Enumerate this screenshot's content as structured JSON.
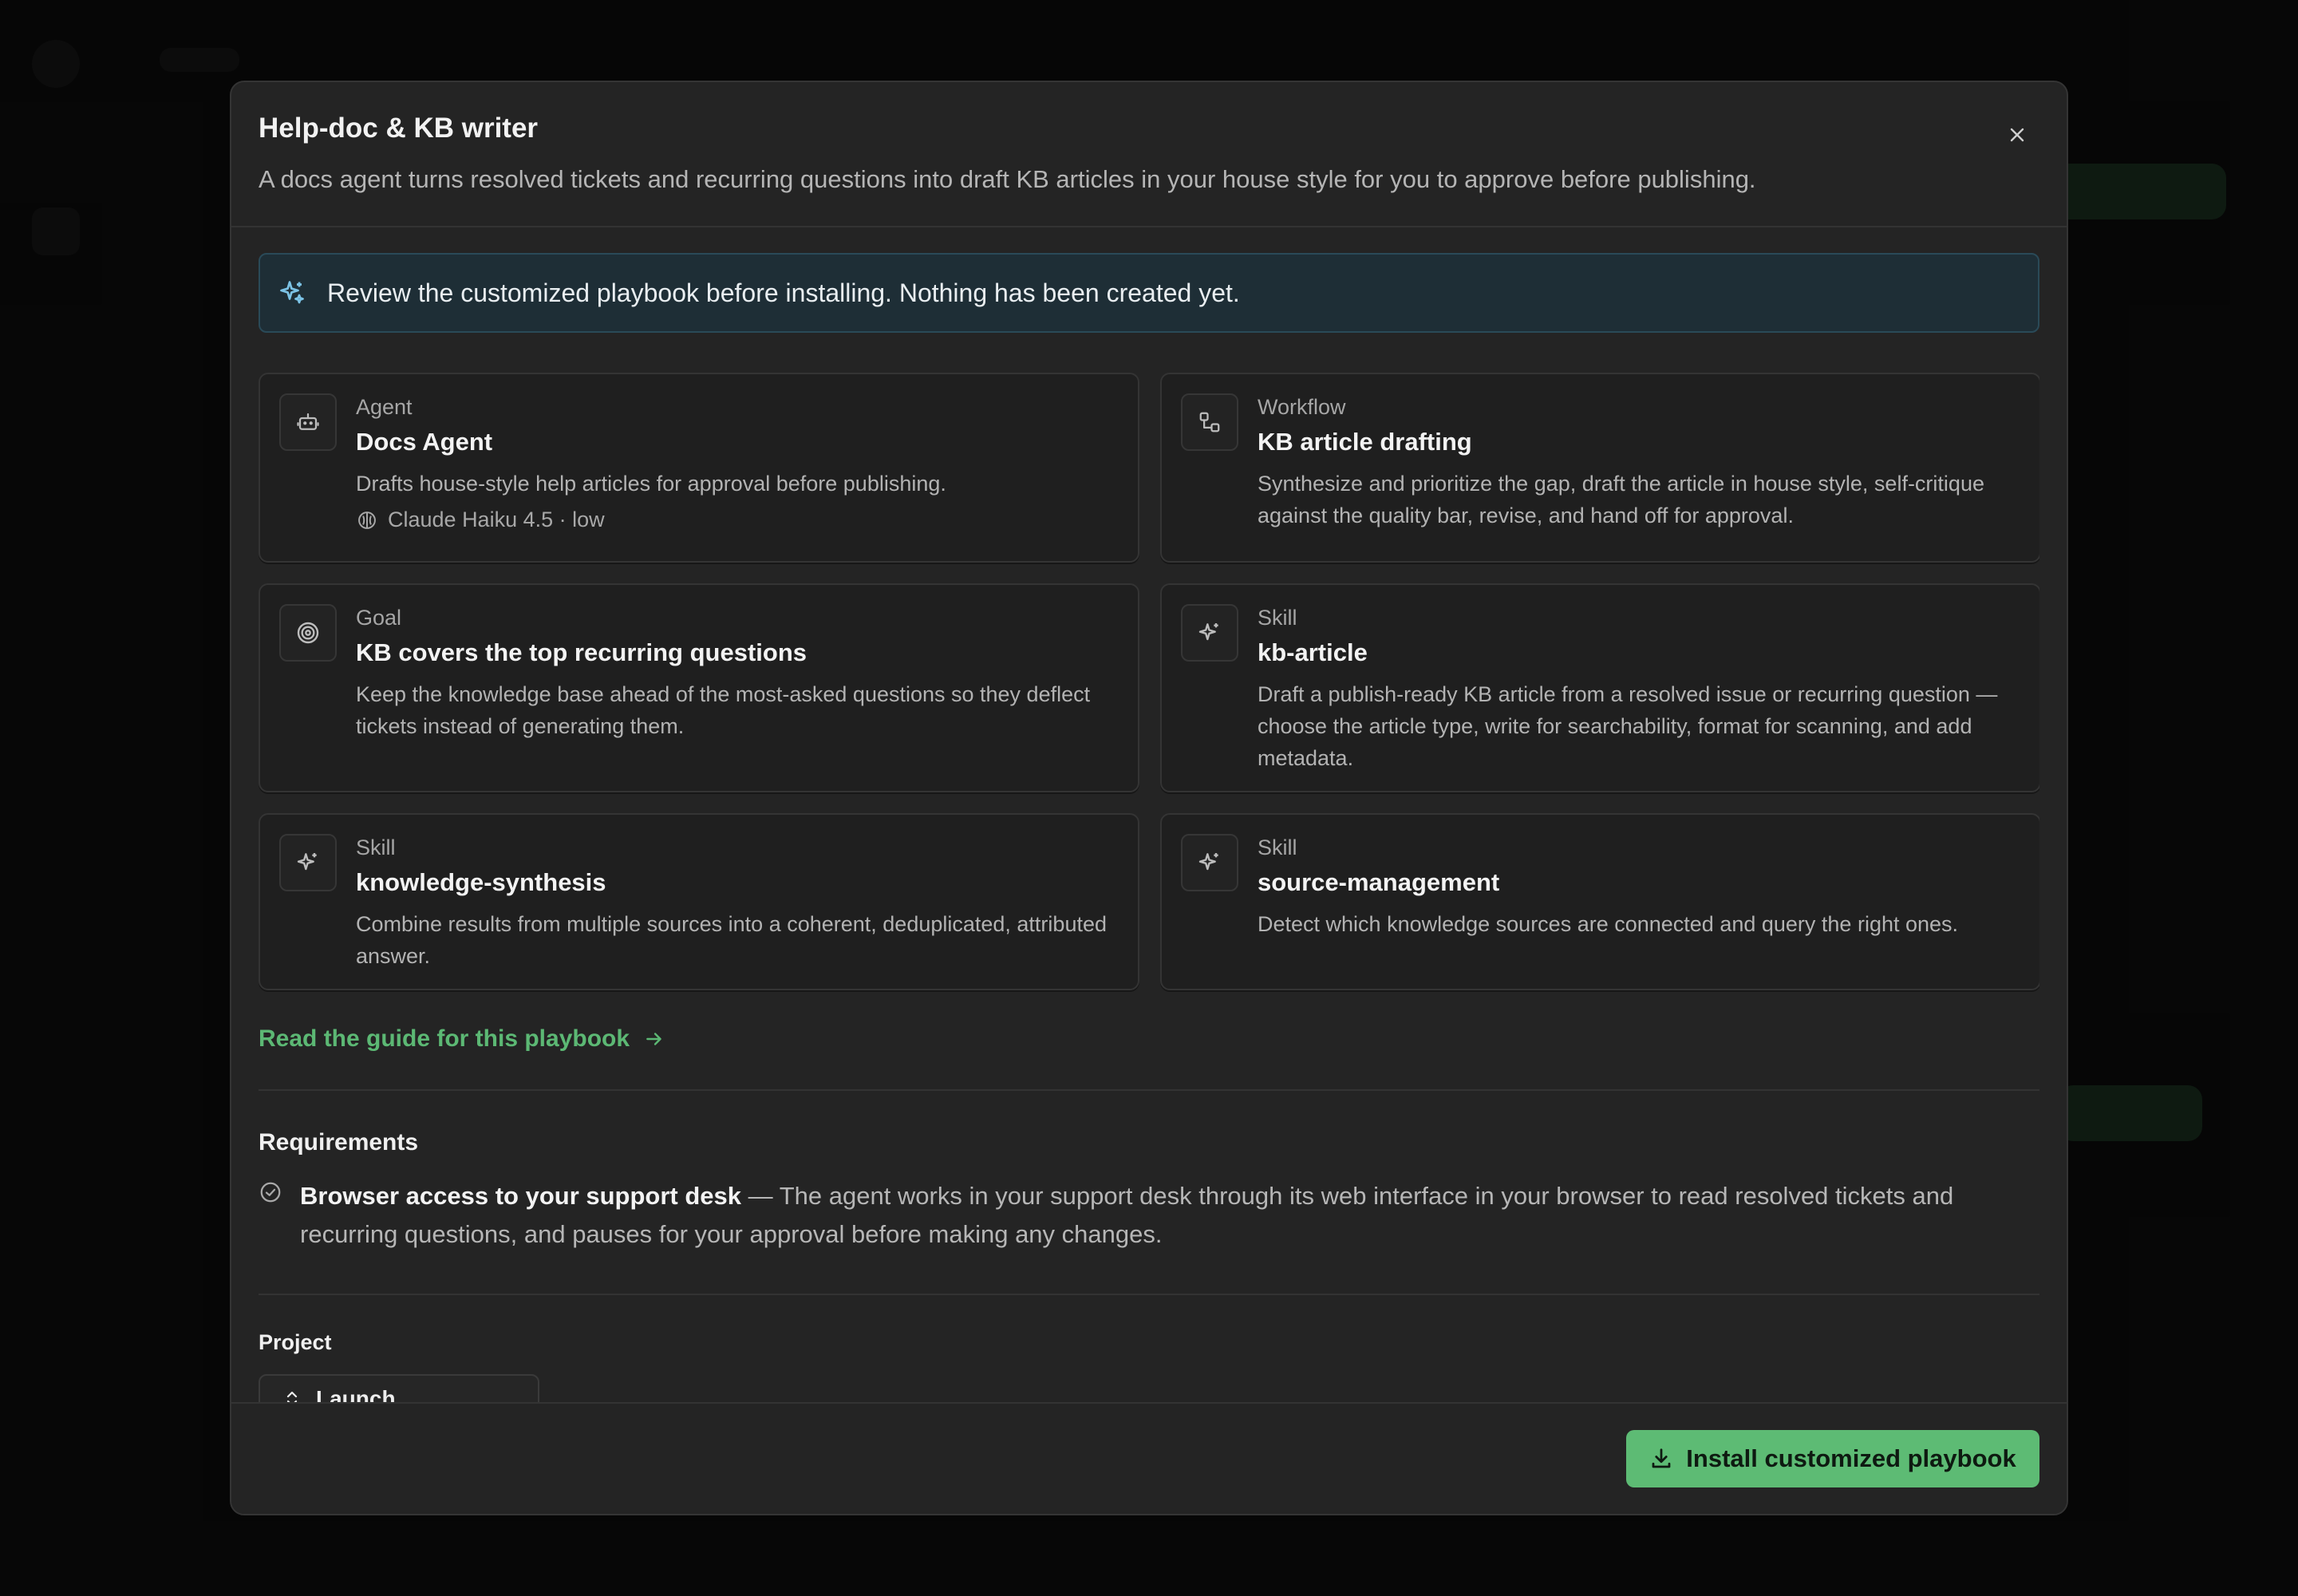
{
  "modal": {
    "title": "Help-doc & KB writer",
    "subtitle": "A docs agent turns resolved tickets and recurring questions into draft KB articles in your house style for you to approve before publishing."
  },
  "notice": {
    "text": "Review the customized playbook before installing. Nothing has been created yet.",
    "icon": "sparkle-icon"
  },
  "cards": [
    {
      "type": "Agent",
      "title": "Docs Agent",
      "description": "Drafts house-style help articles for approval before publishing.",
      "meta": "Claude Haiku 4.5 · low",
      "icon": "robot-icon"
    },
    {
      "type": "Workflow",
      "title": "KB article drafting",
      "description": "Synthesize and prioritize the gap, draft the article in house style, self-critique against the quality bar, revise, and hand off for approval.",
      "icon": "workflow-icon"
    },
    {
      "type": "Goal",
      "title": "KB covers the top recurring questions",
      "description": "Keep the knowledge base ahead of the most-asked questions so they deflect tickets instead of generating them.",
      "icon": "target-icon"
    },
    {
      "type": "Skill",
      "title": "kb-article",
      "description": "Draft a publish-ready KB article from a resolved issue or recurring question — choose the article type, write for searchability, format for scanning, and add metadata.",
      "icon": "sparkle-icon"
    },
    {
      "type": "Skill",
      "title": "knowledge-synthesis",
      "description": "Combine results from multiple sources into a coherent, deduplicated, attributed answer.",
      "icon": "sparkle-icon"
    },
    {
      "type": "Skill",
      "title": "source-management",
      "description": "Detect which knowledge sources are connected and query the right ones.",
      "icon": "sparkle-icon"
    }
  ],
  "guide_link": "Read the guide for this playbook",
  "requirements": {
    "heading": "Requirements",
    "items": [
      {
        "title": "Browser access to your support desk",
        "text": " — The agent works in your support desk through its web interface in your browser to read resolved tickets and recurring questions, and pauses for your approval before making any changes."
      }
    ]
  },
  "project": {
    "label": "Project",
    "selected": "Launch"
  },
  "footer": {
    "install_label": "Install customized playbook"
  },
  "colors": {
    "accent": "#5dbb74",
    "notice_bg": "#1e2e36",
    "modal_bg": "#242424"
  }
}
